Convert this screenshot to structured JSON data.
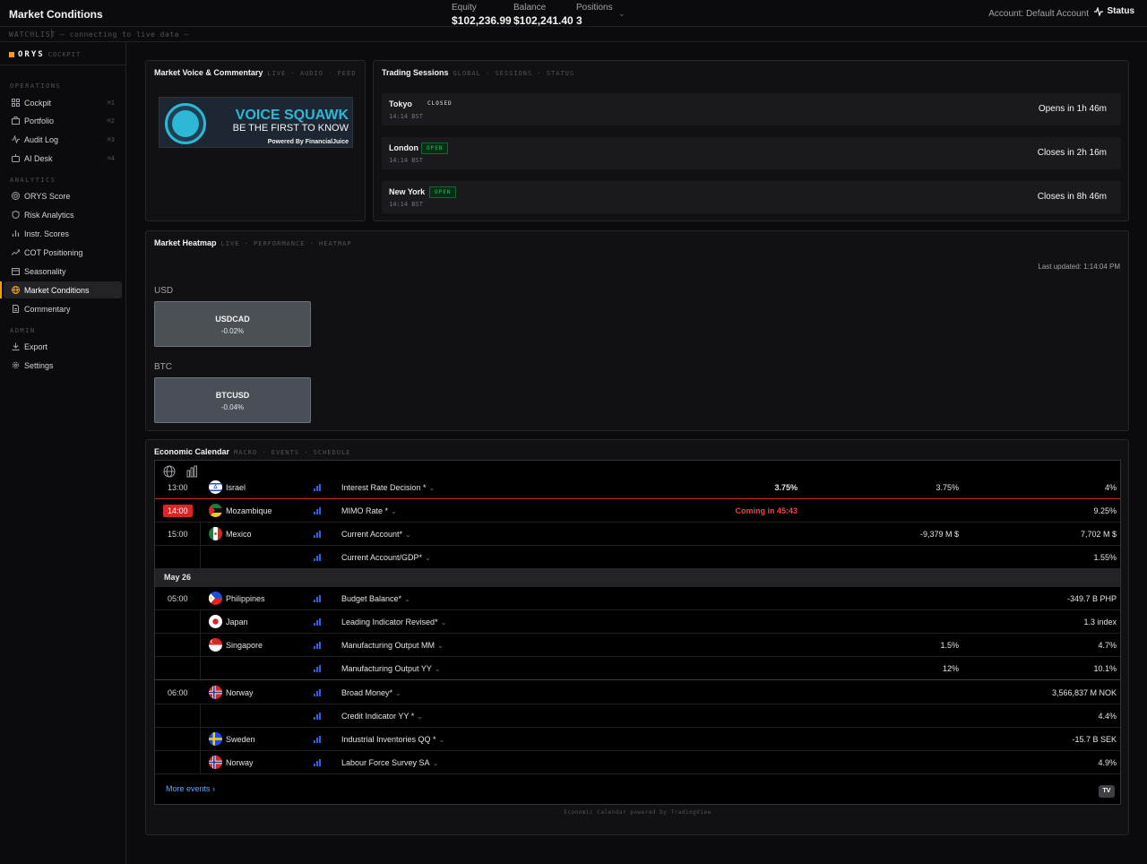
{
  "header": {
    "title": "Market Conditions",
    "equity_label": "Equity",
    "equity_value": "$102,236.99",
    "balance_label": "Balance",
    "balance_value": "$102,241.40",
    "positions_label": "Positions",
    "positions_value": "3",
    "account": "Account: Default Account",
    "status": "Status"
  },
  "watchlist": {
    "label": "WATCHLIST",
    "status": "— connecting to live data —"
  },
  "sidebar": {
    "brand": "ORYS",
    "brand_sub": "COCKPIT",
    "sections": [
      {
        "label": "OPERATIONS",
        "items": [
          {
            "label": "Cockpit",
            "shortcut": "⌘1",
            "icon": "grid-icon"
          },
          {
            "label": "Portfolio",
            "shortcut": "⌘2",
            "icon": "briefcase-icon"
          },
          {
            "label": "Audit Log",
            "shortcut": "⌘3",
            "icon": "activity-icon"
          },
          {
            "label": "AI Desk",
            "shortcut": "⌘4",
            "icon": "bot-icon"
          }
        ]
      },
      {
        "label": "ANALYTICS",
        "items": [
          {
            "label": "ORYS Score",
            "icon": "target-icon"
          },
          {
            "label": "Risk Analytics",
            "icon": "shield-icon"
          },
          {
            "label": "Instr. Scores",
            "icon": "bar-chart-icon"
          },
          {
            "label": "COT Positioning",
            "icon": "trend-icon"
          },
          {
            "label": "Seasonality",
            "icon": "calendar-icon"
          },
          {
            "label": "Market Conditions",
            "icon": "globe-icon",
            "active": true
          },
          {
            "label": "Commentary",
            "icon": "doc-icon"
          }
        ]
      },
      {
        "label": "ADMIN",
        "items": [
          {
            "label": "Export",
            "icon": "download-icon"
          },
          {
            "label": "Settings",
            "icon": "gear-icon"
          }
        ]
      }
    ]
  },
  "voice": {
    "title": "Market Voice & Commentary",
    "subtitle": "LIVE · AUDIO · FEED",
    "banner_title": "VOICE SQUAWK",
    "banner_tagline": "BE THE FIRST TO KNOW",
    "banner_powered": "Powered By FinancialJuice"
  },
  "sessions": {
    "title": "Trading Sessions",
    "subtitle": "GLOBAL · SESSIONS · STATUS",
    "items": [
      {
        "city": "Tokyo",
        "status": "CLOSED",
        "time": "14:14 BST",
        "countdown": "Opens in 1h 46m"
      },
      {
        "city": "London",
        "status": "OPEN",
        "time": "14:14 BST",
        "countdown": "Closes in 2h 16m"
      },
      {
        "city": "New York",
        "status": "OPEN",
        "time": "14:14 BST",
        "countdown": "Closes in 8h 46m"
      }
    ]
  },
  "heatmap": {
    "title": "Market Heatmap",
    "subtitle": "LIVE · PERFORMANCE · HEATMAP",
    "last_updated": "Last updated: 1:14:04 PM",
    "groups": [
      {
        "name": "USD",
        "tiles": [
          {
            "symbol": "USDCAD",
            "change": "-0.02%",
            "color": "#4b5054"
          }
        ]
      },
      {
        "name": "BTC",
        "tiles": [
          {
            "symbol": "BTCUSD",
            "change": "-0.04%",
            "color": "#4a4e56"
          }
        ]
      }
    ]
  },
  "calendar": {
    "title": "Economic Calendar",
    "subtitle": "MACRO · EVENTS · SCHEDULE",
    "rows": [
      {
        "time": "13:00",
        "country": "Israel",
        "event": "Interest Rate Decision *",
        "actual": "3.75%",
        "forecast": "3.75%",
        "prior": "4%"
      },
      {
        "time": "14:00",
        "country": "Mozambique",
        "event": "MIMO Rate *",
        "actual": "Coming in 45:43",
        "forecast": "",
        "prior": "9.25%"
      },
      {
        "time": "15:00",
        "country": "Mexico",
        "event": "Current Account*",
        "actual": "",
        "forecast": "-9,379 M $",
        "prior": "7,702 M $"
      },
      {
        "time": "",
        "country": "",
        "event": "Current Account/GDP*",
        "actual": "",
        "forecast": "",
        "prior": "1.55%"
      },
      {
        "time": "05:00",
        "country": "Philippines",
        "event": "Budget Balance*",
        "actual": "",
        "forecast": "",
        "prior": "-349.7 B PHP"
      },
      {
        "time": "",
        "country": "Japan",
        "event": "Leading Indicator Revised*",
        "actual": "",
        "forecast": "",
        "prior": "1.3 index"
      },
      {
        "time": "",
        "country": "Singapore",
        "event": "Manufacturing Output MM",
        "actual": "",
        "forecast": "1.5%",
        "prior": "4.7%"
      },
      {
        "time": "",
        "country": "",
        "event": "Manufacturing Output YY",
        "actual": "",
        "forecast": "12%",
        "prior": "10.1%"
      },
      {
        "time": "06:00",
        "country": "Norway",
        "event": "Broad Money*",
        "actual": "",
        "forecast": "",
        "prior": "3,566,837 M NOK"
      },
      {
        "time": "",
        "country": "",
        "event": "Credit Indicator YY *",
        "actual": "",
        "forecast": "",
        "prior": "4.4%"
      },
      {
        "time": "",
        "country": "Sweden",
        "event": "Industrial Inventories QQ *",
        "actual": "",
        "forecast": "",
        "prior": "-15.7 B SEK"
      },
      {
        "time": "",
        "country": "Norway",
        "event": "Labour Force Survey SA",
        "actual": "",
        "forecast": "",
        "prior": "4.9%"
      }
    ],
    "date_separator": "May 26",
    "more": "More events",
    "tv_badge": "TV",
    "powered": "Economic Calendar powered by TradingView",
    "colors": {
      "alert": "#dc2626",
      "countdown": "#ef4444",
      "link": "#60a5fa"
    }
  }
}
